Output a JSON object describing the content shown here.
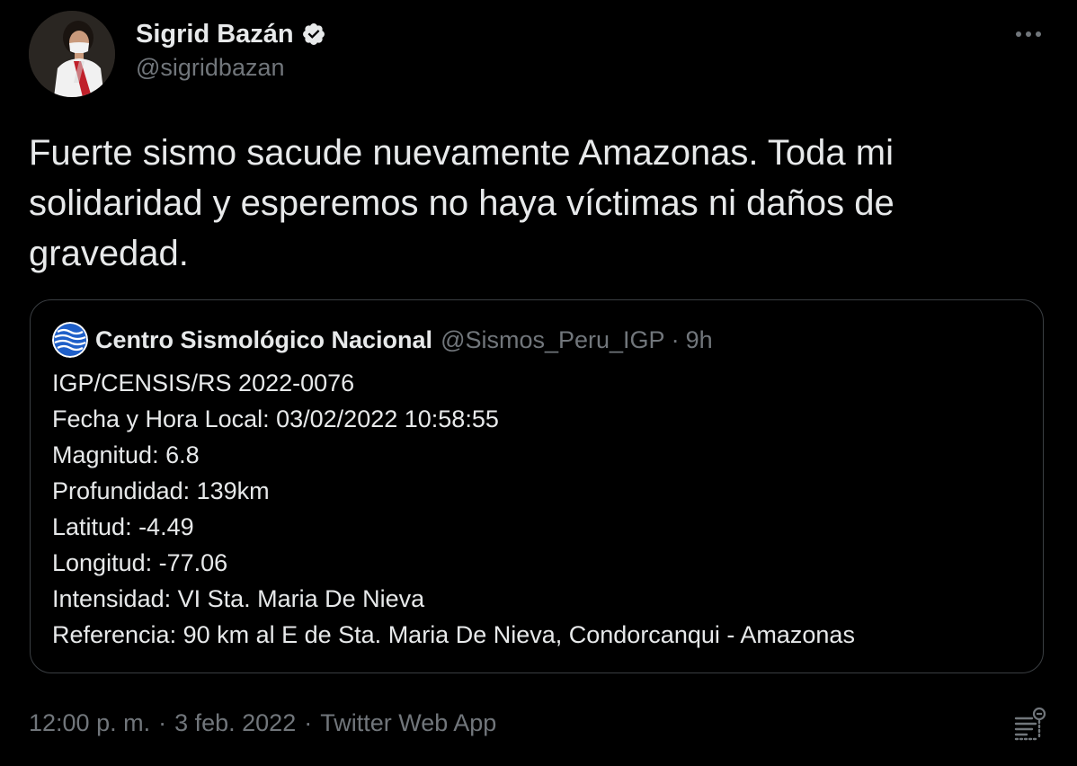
{
  "author": {
    "name": "Sigrid Bazán",
    "handle": "@sigridbazan",
    "verified": true
  },
  "tweet": {
    "text": "Fuerte sismo sacude nuevamente Amazonas. Toda mi solidaridad y esperemos no haya víctimas ni daños de gravedad."
  },
  "quote": {
    "name": "Centro Sismológico Nacional",
    "handle": "@Sismos_Peru_IGP",
    "separator": "·",
    "time": "9h",
    "lines": [
      "IGP/CENSIS/RS 2022-0076",
      "Fecha y Hora Local: 03/02/2022 10:58:55",
      "Magnitud: 6.8",
      "Profundidad: 139km",
      "Latitud: -4.49",
      "Longitud: -77.06",
      "Intensidad: VI Sta. Maria De Nieva",
      "Referencia: 90 km al E de Sta. Maria De Nieva, Condorcanqui - Amazonas"
    ]
  },
  "meta": {
    "time": "12:00 p. m.",
    "separator": "·",
    "date": "3 feb. 2022",
    "source": "Twitter Web App"
  },
  "icons": {
    "more": "more-horizontal-icon",
    "verified": "verified-badge-icon",
    "activity": "tweet-activity-icon"
  },
  "colors": {
    "background": "#000000",
    "text_primary": "#e7e9ea",
    "text_secondary": "#71767b",
    "border": "#3a3e42",
    "verified_badge": "#e7e9ea"
  }
}
